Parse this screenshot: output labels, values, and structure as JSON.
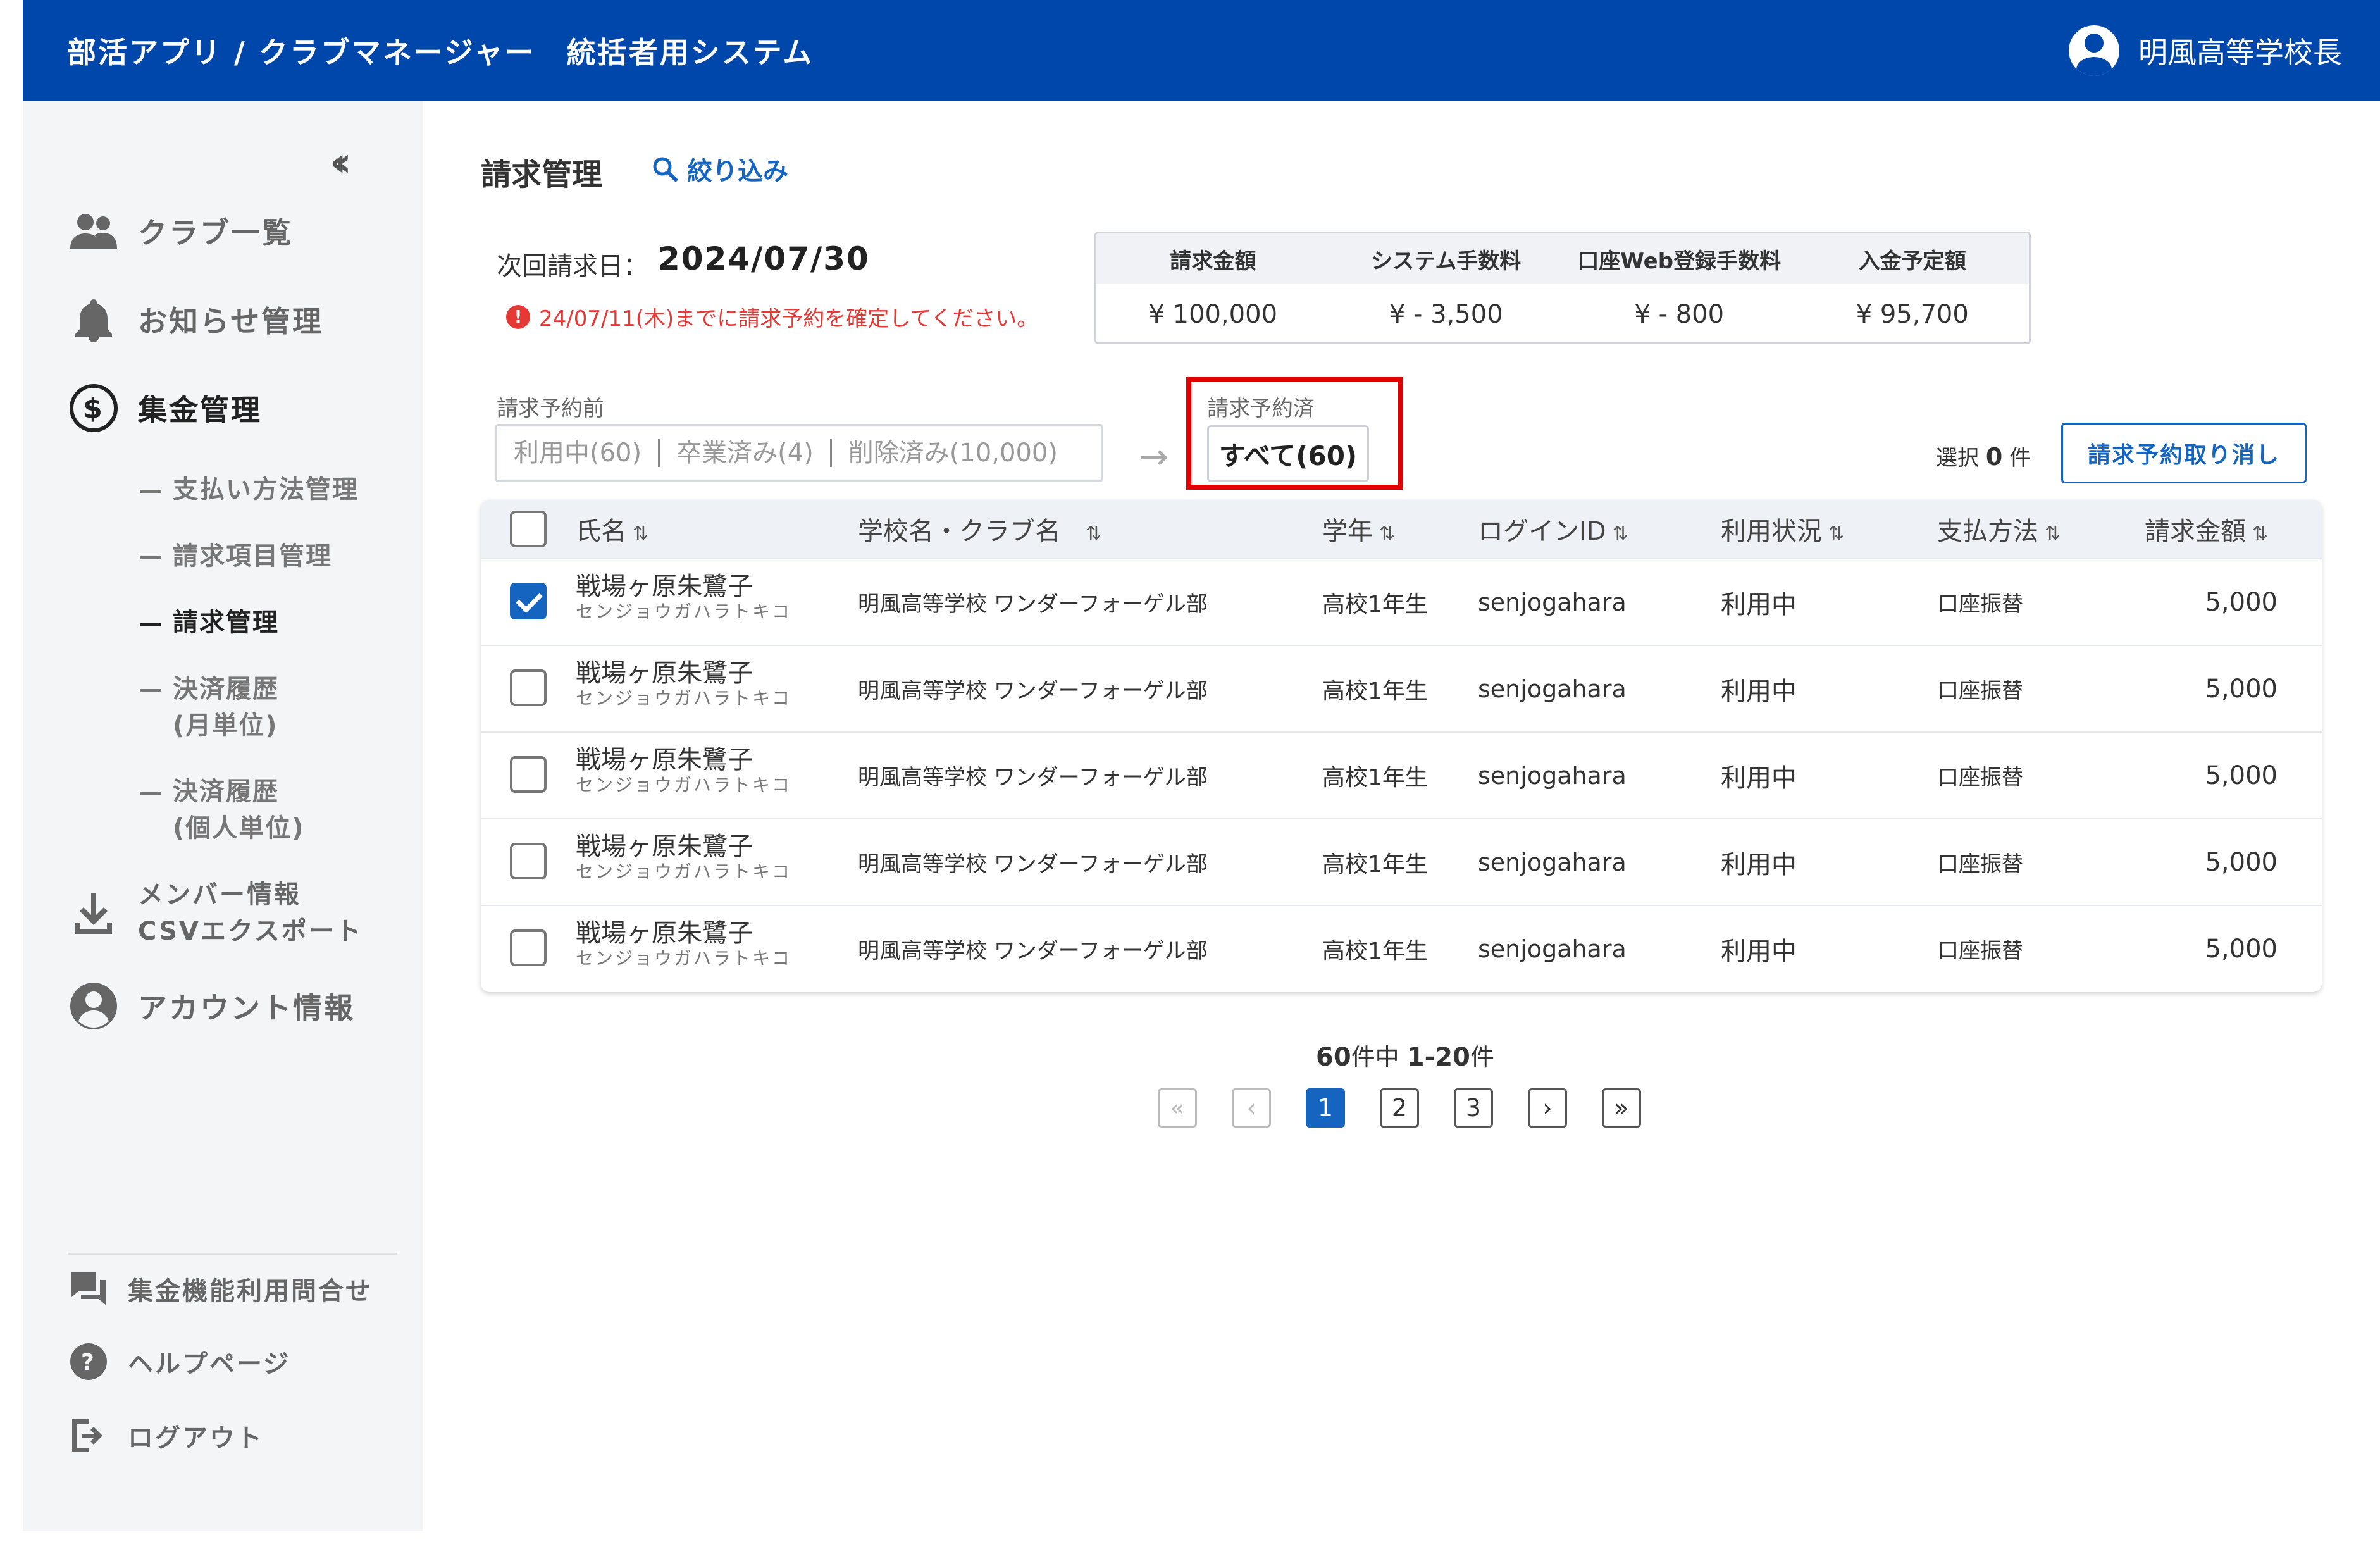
{
  "header": {
    "app_title": "部活アプリ / クラブマネージャー　統括者用システム",
    "user_name": "明風高等学校長"
  },
  "sidebar": {
    "collapse_label": "«",
    "nav": {
      "clubs": "クラブ一覧",
      "notices": "お知らせ管理",
      "collection": "集金管理",
      "export_line1": "メンバー情報",
      "export_line2": "CSVエクスポート",
      "account": "アカウント情報"
    },
    "sub": {
      "payment_methods": "支払い方法管理",
      "billing_items": "請求項目管理",
      "billing": "請求管理",
      "history_monthly_1": "決済履歴",
      "history_monthly_2": "(月単位)",
      "history_personal_1": "決済履歴",
      "history_personal_2": "(個人単位)"
    },
    "footer": {
      "inquiry": "集金機能利用問合せ",
      "help": "ヘルプページ",
      "logout": "ログアウト"
    }
  },
  "main": {
    "title": "請求管理",
    "filter_label": "絞り込み",
    "next_date_label": "次回請求日：",
    "next_date_value": "2024/07/30",
    "warning": "24/07/11(木)までに請求予約を確定してください。",
    "summary": {
      "headers": [
        "請求金額",
        "システム手数料",
        "口座Web登録手数料",
        "入金予定額"
      ],
      "values": [
        "¥ 100,000",
        "¥ - 3,500",
        "¥ - 800",
        "¥ 95,700"
      ]
    },
    "before_label": "請求予約前",
    "before_tabs": [
      "利用中(60)",
      "卒業済み(4)",
      "削除済み(10,000)"
    ],
    "after_label": "請求予約済",
    "after_tab": "すべて(60)",
    "selection_prefix": "選択",
    "selection_count": "0",
    "selection_suffix": "件",
    "cancel_button": "請求予約取り消し"
  },
  "table": {
    "headers": {
      "name": "氏名",
      "school_club": "学校名・クラブ名",
      "grade": "学年",
      "login_id": "ログインID",
      "status": "利用状況",
      "payment": "支払方法",
      "amount": "請求金額"
    },
    "rows": [
      {
        "checked": true,
        "name": "戦場ヶ原朱鷺子",
        "kana": "センジョウガハラトキコ",
        "school": "明風高等学校 ワンダーフォーゲル部",
        "grade": "高校1年生",
        "login": "senjogahara",
        "status": "利用中",
        "payment": "口座振替",
        "amount": "5,000"
      },
      {
        "checked": false,
        "name": "戦場ヶ原朱鷺子",
        "kana": "センジョウガハラトキコ",
        "school": "明風高等学校 ワンダーフォーゲル部",
        "grade": "高校1年生",
        "login": "senjogahara",
        "status": "利用中",
        "payment": "口座振替",
        "amount": "5,000"
      },
      {
        "checked": false,
        "name": "戦場ヶ原朱鷺子",
        "kana": "センジョウガハラトキコ",
        "school": "明風高等学校 ワンダーフォーゲル部",
        "grade": "高校1年生",
        "login": "senjogahara",
        "status": "利用中",
        "payment": "口座振替",
        "amount": "5,000"
      },
      {
        "checked": false,
        "name": "戦場ヶ原朱鷺子",
        "kana": "センジョウガハラトキコ",
        "school": "明風高等学校 ワンダーフォーゲル部",
        "grade": "高校1年生",
        "login": "senjogahara",
        "status": "利用中",
        "payment": "口座振替",
        "amount": "5,000"
      },
      {
        "checked": false,
        "name": "戦場ヶ原朱鷺子",
        "kana": "センジョウガハラトキコ",
        "school": "明風高等学校 ワンダーフォーゲル部",
        "grade": "高校1年生",
        "login": "senjogahara",
        "status": "利用中",
        "payment": "口座振替",
        "amount": "5,000"
      }
    ]
  },
  "pagination": {
    "total": "60",
    "total_suffix": "件中",
    "range": "1-20",
    "range_suffix": "件",
    "first": "«",
    "prev": "‹",
    "pages": [
      "1",
      "2",
      "3"
    ],
    "current_page": "1",
    "next": "›",
    "last": "»"
  },
  "colors": {
    "header_bg": "#0047ab",
    "accent": "#1565c0",
    "warning": "#e53935",
    "highlight": "#e00000"
  }
}
